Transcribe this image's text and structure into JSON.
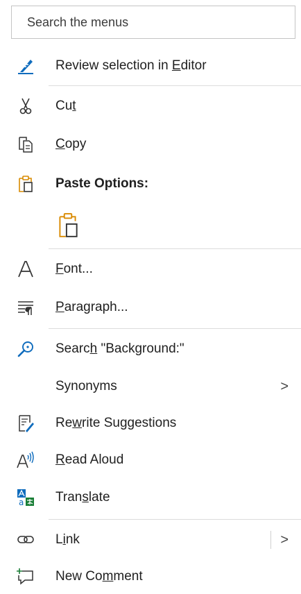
{
  "search": {
    "placeholder": "Search the menus"
  },
  "items": {
    "review": {
      "label_pre": "Review selection in ",
      "label_acc": "E",
      "label_post": "ditor",
      "icon": "editor-pen-icon"
    },
    "cut": {
      "label_pre": "Cu",
      "label_acc": "t",
      "label_post": "",
      "icon": "scissors-icon"
    },
    "copy": {
      "label_pre": "",
      "label_acc": "C",
      "label_post": "opy",
      "icon": "copy-icon"
    },
    "paste_options": {
      "label": "Paste Options:",
      "icon": "clipboard-icon"
    },
    "paste_keep": {
      "icon": "paste-keep-text-icon"
    },
    "font": {
      "label_pre": "",
      "label_acc": "F",
      "label_post": "ont...",
      "icon": "font-icon"
    },
    "paragraph": {
      "label_pre": "",
      "label_acc": "P",
      "label_post": "aragraph...",
      "icon": "paragraph-icon"
    },
    "search": {
      "label_pre": "Searc",
      "label_acc": "h",
      "label_post": " \"Background:\"",
      "icon": "search-icon"
    },
    "synonyms": {
      "label": "Synonyms",
      "chevron": ">"
    },
    "rewrite": {
      "label_pre": "Re",
      "label_acc": "w",
      "label_post": "rite Suggestions",
      "icon": "rewrite-icon"
    },
    "read_aloud": {
      "label_pre": "",
      "label_acc": "R",
      "label_post": "ead Aloud",
      "icon": "read-aloud-icon"
    },
    "translate": {
      "label_pre": "Tran",
      "label_acc": "s",
      "label_post": "late",
      "icon": "translate-icon"
    },
    "link": {
      "label_pre": "L",
      "label_acc": "i",
      "label_post": "nk",
      "chevron": ">",
      "icon": "link-icon"
    },
    "new_comment": {
      "label_pre": "New Co",
      "label_acc": "m",
      "label_post": "ment",
      "icon": "new-comment-icon"
    }
  },
  "colors": {
    "accent": "#0f6cbd",
    "paste_orange": "#d98a00",
    "border": "#c4c4c4",
    "separator": "#dcdcdc"
  }
}
